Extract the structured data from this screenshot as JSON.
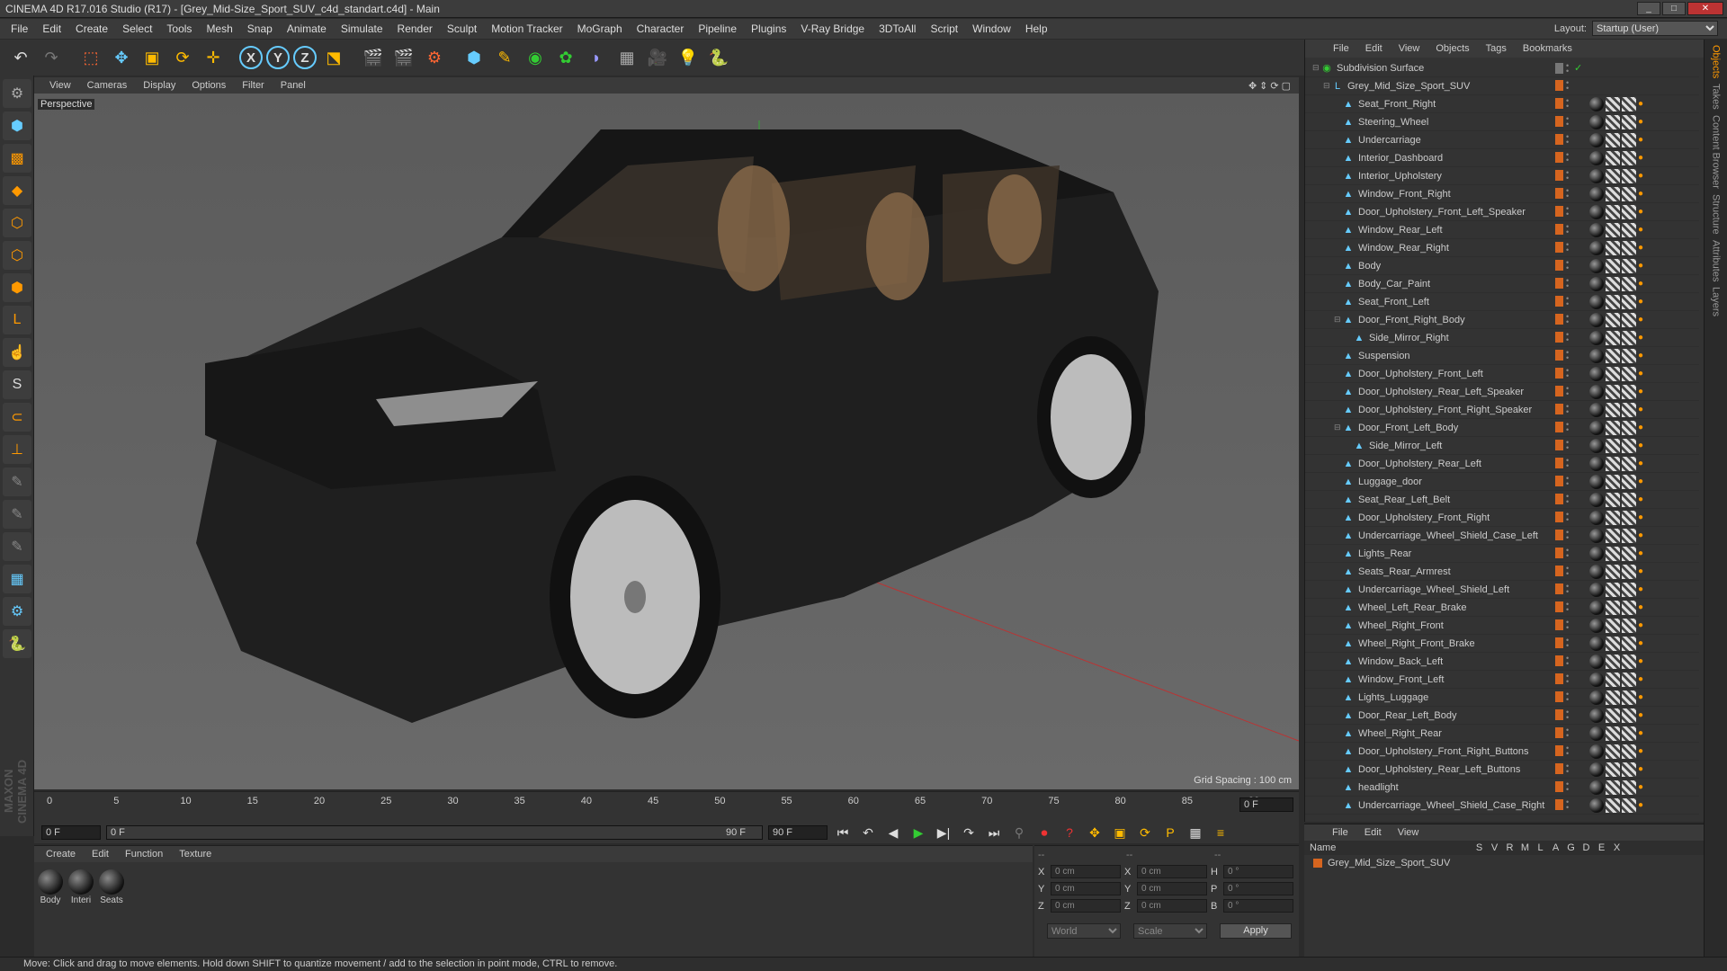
{
  "window": {
    "title": "CINEMA 4D R17.016 Studio (R17) - [Grey_Mid-Size_Sport_SUV_c4d_standart.c4d] - Main"
  },
  "menubar": {
    "items": [
      "File",
      "Edit",
      "Create",
      "Select",
      "Tools",
      "Mesh",
      "Snap",
      "Animate",
      "Simulate",
      "Render",
      "Sculpt",
      "Motion Tracker",
      "MoGraph",
      "Character",
      "Pipeline",
      "Plugins",
      "V-Ray Bridge",
      "3DToAll",
      "Script",
      "Window",
      "Help"
    ],
    "layout_label": "Layout:",
    "layout_value": "Startup (User)"
  },
  "viewport": {
    "menu": [
      "View",
      "Cameras",
      "Display",
      "Options",
      "Filter",
      "Panel"
    ],
    "camera_label": "Perspective",
    "grid_spacing": "Grid Spacing : 100 cm"
  },
  "timeline": {
    "ticks": [
      "0",
      "5",
      "10",
      "15",
      "20",
      "25",
      "30",
      "35",
      "40",
      "45",
      "50",
      "55",
      "60",
      "65",
      "70",
      "75",
      "80",
      "85",
      "90"
    ],
    "current_frame": "0 F",
    "start_field": "0 F",
    "range_start": "0 F",
    "range_end": "90 F",
    "end_field": "90 F"
  },
  "materials": {
    "menu": [
      "Create",
      "Edit",
      "Function",
      "Texture"
    ],
    "items": [
      {
        "label": "Body"
      },
      {
        "label": "Interi"
      },
      {
        "label": "Seats"
      }
    ]
  },
  "coords": {
    "header": [
      "--",
      "--",
      "--"
    ],
    "rows": [
      {
        "a": "X",
        "av": "0 cm",
        "b": "X",
        "bv": "0 cm",
        "c": "H",
        "cv": "0 °"
      },
      {
        "a": "Y",
        "av": "0 cm",
        "b": "Y",
        "bv": "0 cm",
        "c": "P",
        "cv": "0 °"
      },
      {
        "a": "Z",
        "av": "0 cm",
        "b": "Z",
        "bv": "0 cm",
        "c": "B",
        "cv": "0 °"
      }
    ],
    "space": "World",
    "mode": "Scale",
    "apply": "Apply"
  },
  "object_manager": {
    "menu": [
      "File",
      "Edit",
      "View",
      "Objects",
      "Tags",
      "Bookmarks"
    ],
    "objects": [
      {
        "name": "Subdivision Surface",
        "depth": 0
      },
      {
        "name": "Grey_Mid_Size_Sport_SUV",
        "depth": 1
      },
      {
        "name": "Seat_Front_Right",
        "depth": 2
      },
      {
        "name": "Steering_Wheel",
        "depth": 2
      },
      {
        "name": "Undercarriage",
        "depth": 2
      },
      {
        "name": "Interior_Dashboard",
        "depth": 2
      },
      {
        "name": "Interior_Upholstery",
        "depth": 2
      },
      {
        "name": "Window_Front_Right",
        "depth": 2
      },
      {
        "name": "Door_Upholstery_Front_Left_Speaker",
        "depth": 2
      },
      {
        "name": "Window_Rear_Left",
        "depth": 2
      },
      {
        "name": "Window_Rear_Right",
        "depth": 2
      },
      {
        "name": "Body",
        "depth": 2
      },
      {
        "name": "Body_Car_Paint",
        "depth": 2
      },
      {
        "name": "Seat_Front_Left",
        "depth": 2
      },
      {
        "name": "Door_Front_Right_Body",
        "depth": 2
      },
      {
        "name": "Side_Mirror_Right",
        "depth": 3
      },
      {
        "name": "Suspension",
        "depth": 2
      },
      {
        "name": "Door_Upholstery_Front_Left",
        "depth": 2
      },
      {
        "name": "Door_Upholstery_Rear_Left_Speaker",
        "depth": 2
      },
      {
        "name": "Door_Upholstery_Front_Right_Speaker",
        "depth": 2
      },
      {
        "name": "Door_Front_Left_Body",
        "depth": 2
      },
      {
        "name": "Side_Mirror_Left",
        "depth": 3
      },
      {
        "name": "Door_Upholstery_Rear_Left",
        "depth": 2
      },
      {
        "name": "Luggage_door",
        "depth": 2
      },
      {
        "name": "Seat_Rear_Left_Belt",
        "depth": 2
      },
      {
        "name": "Door_Upholstery_Front_Right",
        "depth": 2
      },
      {
        "name": "Undercarriage_Wheel_Shield_Case_Left",
        "depth": 2
      },
      {
        "name": "Lights_Rear",
        "depth": 2
      },
      {
        "name": "Seats_Rear_Armrest",
        "depth": 2
      },
      {
        "name": "Undercarriage_Wheel_Shield_Left",
        "depth": 2
      },
      {
        "name": "Wheel_Left_Rear_Brake",
        "depth": 2
      },
      {
        "name": "Wheel_Right_Front",
        "depth": 2
      },
      {
        "name": "Wheel_Right_Front_Brake",
        "depth": 2
      },
      {
        "name": "Window_Back_Left",
        "depth": 2
      },
      {
        "name": "Window_Front_Left",
        "depth": 2
      },
      {
        "name": "Lights_Luggage",
        "depth": 2
      },
      {
        "name": "Door_Rear_Left_Body",
        "depth": 2
      },
      {
        "name": "Wheel_Right_Rear",
        "depth": 2
      },
      {
        "name": "Door_Upholstery_Front_Right_Buttons",
        "depth": 2
      },
      {
        "name": "Door_Upholstery_Rear_Left_Buttons",
        "depth": 2
      },
      {
        "name": "headlight",
        "depth": 2
      },
      {
        "name": "Undercarriage_Wheel_Shield_Case_Right",
        "depth": 2
      }
    ]
  },
  "layer_manager": {
    "menu": [
      "File",
      "Edit",
      "View"
    ],
    "name_header": "Name",
    "columns": [
      "S",
      "V",
      "R",
      "M",
      "L",
      "A",
      "G",
      "D",
      "E",
      "X"
    ],
    "layers": [
      {
        "name": "Grey_Mid_Size_Sport_SUV"
      }
    ]
  },
  "right_tabs": [
    "Objects",
    "Takes",
    "Content Browser",
    "Structure",
    "Attributes",
    "Layers"
  ],
  "status": "Move: Click and drag to move elements. Hold down SHIFT to quantize movement / add to the selection in point mode, CTRL to remove.",
  "brand": "MAXON CINEMA 4D",
  "colors": {
    "accent_orange": "#d6651f",
    "icon_blue": "#66ccff",
    "play_green": "#33cc33"
  }
}
